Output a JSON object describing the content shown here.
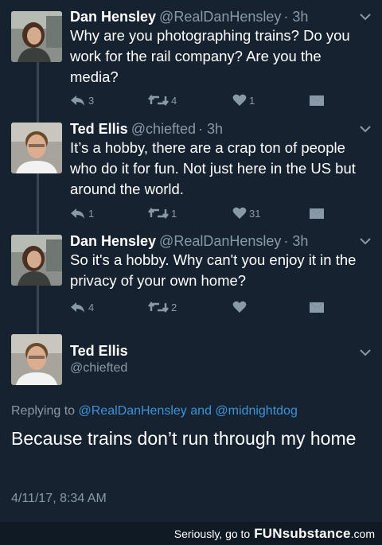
{
  "thread": [
    {
      "name": "Dan Hensley",
      "handle": "@RealDanHensley",
      "time": "· 3h",
      "text": "Why are you photographing trains? Do you work for the rail company? Are you the media?",
      "reply_count": "3",
      "retweet_count": "4",
      "like_count": "1",
      "avatar": "dan-hensley-avatar"
    },
    {
      "name": "Ted Ellis",
      "handle": "@chiefted",
      "time": "· 3h",
      "text": "It’s a hobby, there are a crap ton of people who do it for fun. Not just here in the US but around the world.",
      "reply_count": "1",
      "retweet_count": "1",
      "like_count": "31",
      "avatar": "ted-ellis-avatar"
    },
    {
      "name": "Dan Hensley",
      "handle": "@RealDanHensley",
      "time": "· 3h",
      "text": "So it's a hobby. Why can't you enjoy it in the privacy of your own home?",
      "reply_count": "4",
      "retweet_count": "2",
      "like_count": "",
      "avatar": "dan-hensley-avatar"
    }
  ],
  "main_tweet": {
    "name": "Ted Ellis",
    "handle": "@chiefted",
    "replying_prefix": "Replying to",
    "mention_1": "@RealDanHensley",
    "and_word": "and",
    "mention_2": "@midnightdog",
    "text": "Because trains don’t run through my home",
    "timestamp": "4/11/17, 8:34 AM"
  },
  "watermark": {
    "prefix": "Seriously, go to",
    "brand": "FUNsubstance",
    "domain": ".com"
  },
  "icons": {
    "reply": "reply-icon",
    "retweet": "retweet-icon",
    "like": "heart-icon",
    "dm": "envelope-icon",
    "more": "chevron-down-icon"
  },
  "colors": {
    "background": "#162230",
    "muted_text": "#8a99a7",
    "link": "#3b94d9",
    "thread_line": "#38444f"
  }
}
